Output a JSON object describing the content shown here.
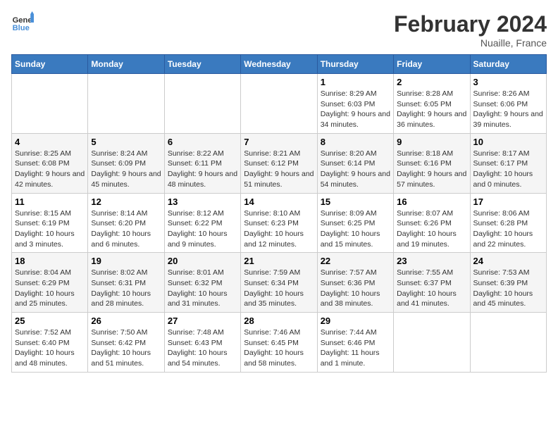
{
  "header": {
    "logo_general": "General",
    "logo_blue": "Blue",
    "main_title": "February 2024",
    "subtitle": "Nuaille, France"
  },
  "days_of_week": [
    "Sunday",
    "Monday",
    "Tuesday",
    "Wednesday",
    "Thursday",
    "Friday",
    "Saturday"
  ],
  "weeks": [
    [
      {
        "day": "",
        "info": ""
      },
      {
        "day": "",
        "info": ""
      },
      {
        "day": "",
        "info": ""
      },
      {
        "day": "",
        "info": ""
      },
      {
        "day": "1",
        "info": "Sunrise: 8:29 AM\nSunset: 6:03 PM\nDaylight: 9 hours and 34 minutes."
      },
      {
        "day": "2",
        "info": "Sunrise: 8:28 AM\nSunset: 6:05 PM\nDaylight: 9 hours and 36 minutes."
      },
      {
        "day": "3",
        "info": "Sunrise: 8:26 AM\nSunset: 6:06 PM\nDaylight: 9 hours and 39 minutes."
      }
    ],
    [
      {
        "day": "4",
        "info": "Sunrise: 8:25 AM\nSunset: 6:08 PM\nDaylight: 9 hours and 42 minutes."
      },
      {
        "day": "5",
        "info": "Sunrise: 8:24 AM\nSunset: 6:09 PM\nDaylight: 9 hours and 45 minutes."
      },
      {
        "day": "6",
        "info": "Sunrise: 8:22 AM\nSunset: 6:11 PM\nDaylight: 9 hours and 48 minutes."
      },
      {
        "day": "7",
        "info": "Sunrise: 8:21 AM\nSunset: 6:12 PM\nDaylight: 9 hours and 51 minutes."
      },
      {
        "day": "8",
        "info": "Sunrise: 8:20 AM\nSunset: 6:14 PM\nDaylight: 9 hours and 54 minutes."
      },
      {
        "day": "9",
        "info": "Sunrise: 8:18 AM\nSunset: 6:16 PM\nDaylight: 9 hours and 57 minutes."
      },
      {
        "day": "10",
        "info": "Sunrise: 8:17 AM\nSunset: 6:17 PM\nDaylight: 10 hours and 0 minutes."
      }
    ],
    [
      {
        "day": "11",
        "info": "Sunrise: 8:15 AM\nSunset: 6:19 PM\nDaylight: 10 hours and 3 minutes."
      },
      {
        "day": "12",
        "info": "Sunrise: 8:14 AM\nSunset: 6:20 PM\nDaylight: 10 hours and 6 minutes."
      },
      {
        "day": "13",
        "info": "Sunrise: 8:12 AM\nSunset: 6:22 PM\nDaylight: 10 hours and 9 minutes."
      },
      {
        "day": "14",
        "info": "Sunrise: 8:10 AM\nSunset: 6:23 PM\nDaylight: 10 hours and 12 minutes."
      },
      {
        "day": "15",
        "info": "Sunrise: 8:09 AM\nSunset: 6:25 PM\nDaylight: 10 hours and 15 minutes."
      },
      {
        "day": "16",
        "info": "Sunrise: 8:07 AM\nSunset: 6:26 PM\nDaylight: 10 hours and 19 minutes."
      },
      {
        "day": "17",
        "info": "Sunrise: 8:06 AM\nSunset: 6:28 PM\nDaylight: 10 hours and 22 minutes."
      }
    ],
    [
      {
        "day": "18",
        "info": "Sunrise: 8:04 AM\nSunset: 6:29 PM\nDaylight: 10 hours and 25 minutes."
      },
      {
        "day": "19",
        "info": "Sunrise: 8:02 AM\nSunset: 6:31 PM\nDaylight: 10 hours and 28 minutes."
      },
      {
        "day": "20",
        "info": "Sunrise: 8:01 AM\nSunset: 6:32 PM\nDaylight: 10 hours and 31 minutes."
      },
      {
        "day": "21",
        "info": "Sunrise: 7:59 AM\nSunset: 6:34 PM\nDaylight: 10 hours and 35 minutes."
      },
      {
        "day": "22",
        "info": "Sunrise: 7:57 AM\nSunset: 6:36 PM\nDaylight: 10 hours and 38 minutes."
      },
      {
        "day": "23",
        "info": "Sunrise: 7:55 AM\nSunset: 6:37 PM\nDaylight: 10 hours and 41 minutes."
      },
      {
        "day": "24",
        "info": "Sunrise: 7:53 AM\nSunset: 6:39 PM\nDaylight: 10 hours and 45 minutes."
      }
    ],
    [
      {
        "day": "25",
        "info": "Sunrise: 7:52 AM\nSunset: 6:40 PM\nDaylight: 10 hours and 48 minutes."
      },
      {
        "day": "26",
        "info": "Sunrise: 7:50 AM\nSunset: 6:42 PM\nDaylight: 10 hours and 51 minutes."
      },
      {
        "day": "27",
        "info": "Sunrise: 7:48 AM\nSunset: 6:43 PM\nDaylight: 10 hours and 54 minutes."
      },
      {
        "day": "28",
        "info": "Sunrise: 7:46 AM\nSunset: 6:45 PM\nDaylight: 10 hours and 58 minutes."
      },
      {
        "day": "29",
        "info": "Sunrise: 7:44 AM\nSunset: 6:46 PM\nDaylight: 11 hours and 1 minute."
      },
      {
        "day": "",
        "info": ""
      },
      {
        "day": "",
        "info": ""
      }
    ]
  ]
}
